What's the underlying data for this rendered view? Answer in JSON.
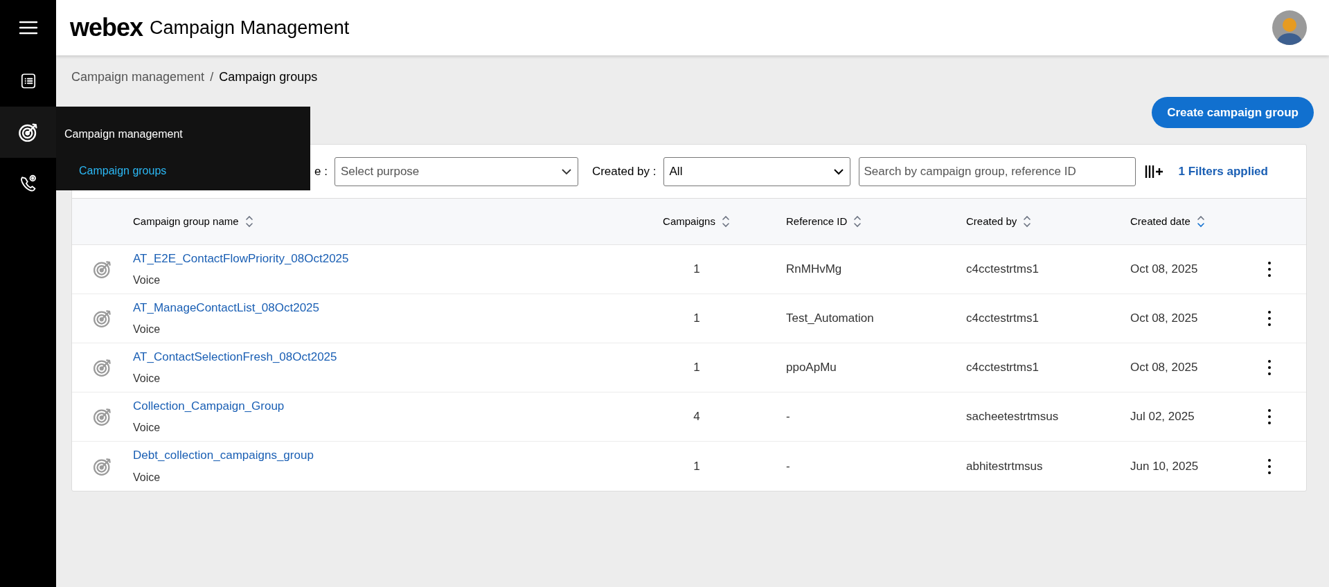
{
  "app": {
    "logo": "webex",
    "title": "Campaign Management"
  },
  "sidebar": {
    "items": [
      {
        "kind": "list",
        "selected": false
      },
      {
        "kind": "target",
        "selected": true
      },
      {
        "kind": "phone",
        "selected": false
      }
    ]
  },
  "flyout": {
    "title": "Campaign management",
    "items": [
      {
        "label": "Campaign groups",
        "selected": true
      }
    ]
  },
  "breadcrumb": [
    {
      "label": "Campaign management",
      "current": false
    },
    {
      "label": "Campaign groups",
      "current": true
    }
  ],
  "breadcrumb_separator": "/",
  "create_button": "Create campaign group",
  "filters": {
    "purpose_label": "e :",
    "purpose_placeholder": "Select purpose",
    "created_by_label": "Created by :",
    "created_by_value": "All",
    "search_placeholder": "Search by campaign group, reference ID",
    "applied": "1 Filters applied"
  },
  "table": {
    "columns": [
      {
        "label": "Campaign group name",
        "sorted": false
      },
      {
        "label": "Campaigns",
        "sorted": false
      },
      {
        "label": "Reference ID",
        "sorted": false
      },
      {
        "label": "Created by",
        "sorted": false
      },
      {
        "label": "Created date",
        "sorted": true
      }
    ],
    "rows": [
      {
        "name": "AT_E2E_ContactFlowPriority_08Oct2025",
        "type": "Voice",
        "campaigns": "1",
        "reference_id": "RnMHvMg",
        "created_by": "c4cctestrtms1",
        "created_date": "Oct 08, 2025"
      },
      {
        "name": "AT_ManageContactList_08Oct2025",
        "type": "Voice",
        "campaigns": "1",
        "reference_id": "Test_Automation",
        "created_by": "c4cctestrtms1",
        "created_date": "Oct 08, 2025"
      },
      {
        "name": "AT_ContactSelectionFresh_08Oct2025",
        "type": "Voice",
        "campaigns": "1",
        "reference_id": "ppoApMu",
        "created_by": "c4cctestrtms1",
        "created_date": "Oct 08, 2025"
      },
      {
        "name": "Collection_Campaign_Group",
        "type": "Voice",
        "campaigns": "4",
        "reference_id": "-",
        "created_by": "sacheetestrtmsus",
        "created_date": "Jul 02, 2025"
      },
      {
        "name": "Debt_collection_campaigns_group",
        "type": "Voice",
        "campaigns": "1",
        "reference_id": "-",
        "created_by": "abhitestrtmsus",
        "created_date": "Jun 10, 2025"
      }
    ]
  }
}
